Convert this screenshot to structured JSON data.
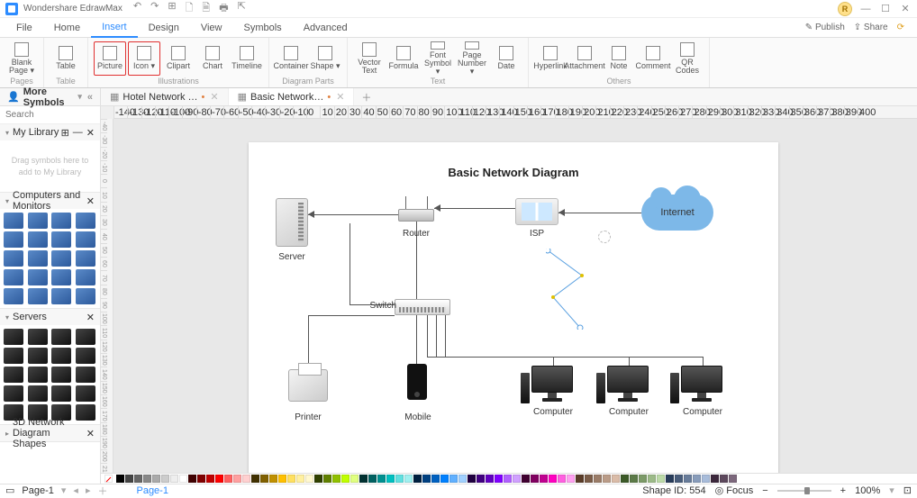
{
  "app": {
    "title": "Wondershare EdrawMax"
  },
  "qat": [
    "↶",
    "↷",
    "⊞",
    "🗋",
    "🗎",
    "🖶",
    "⇱"
  ],
  "winbtns": [
    "—",
    "☐",
    "✕"
  ],
  "avatar": "R",
  "menu": {
    "tabs": [
      "File",
      "Home",
      "Insert",
      "Design",
      "View",
      "Symbols",
      "Advanced"
    ],
    "active": "Insert",
    "right": [
      "✎ Publish",
      "⇪ Share"
    ]
  },
  "ribbon": {
    "groups": [
      {
        "label": "Pages",
        "items": [
          {
            "label": "Blank\nPage ▾"
          }
        ]
      },
      {
        "label": "Table",
        "items": [
          {
            "label": "Table"
          }
        ]
      },
      {
        "label": "Illustrations",
        "items": [
          {
            "label": "Picture"
          },
          {
            "label": "Icon\n▾"
          },
          {
            "label": "Clipart"
          },
          {
            "label": "Chart"
          },
          {
            "label": "Timeline"
          }
        ],
        "highlight": [
          0,
          1
        ]
      },
      {
        "label": "Diagram Parts",
        "items": [
          {
            "label": "Container"
          },
          {
            "label": "Shape\n▾"
          }
        ]
      },
      {
        "label": "Text",
        "items": [
          {
            "label": "Vector\nText"
          },
          {
            "label": "Formula"
          },
          {
            "label": "Font\nSymbol ▾"
          },
          {
            "label": "Page\nNumber ▾"
          },
          {
            "label": "Date"
          }
        ]
      },
      {
        "label": "Others",
        "items": [
          {
            "label": "Hyperlink"
          },
          {
            "label": "Attachment"
          },
          {
            "label": "Note"
          },
          {
            "label": "Comment"
          },
          {
            "label": "QR\nCodes"
          }
        ]
      }
    ]
  },
  "more_symbols": "More Symbols",
  "search_placeholder": "Search",
  "panels": [
    {
      "title": "My Library",
      "empty": "Drag symbols\nhere to add to\nMy Library",
      "tools": [
        "⊞",
        "—",
        "✕"
      ]
    },
    {
      "title": "Computers and Monitors",
      "tools": [
        "✕"
      ],
      "count": 20,
      "style": "blue"
    },
    {
      "title": "Servers",
      "tools": [
        "✕"
      ],
      "count": 20,
      "style": "dark"
    },
    {
      "title": "3D Network Diagram Shapes",
      "tools": [
        "✕"
      ],
      "collapsed": true
    }
  ],
  "doctabs": [
    {
      "label": "Hotel Network …",
      "active": false
    },
    {
      "label": "Basic Network…",
      "active": true
    }
  ],
  "ruler_ticks": [
    "-140",
    "-130",
    "-120",
    "-110",
    "-100",
    "-90",
    "-80",
    "-70",
    "-60",
    "-50",
    "-40",
    "-30",
    "-20",
    "-10",
    "0",
    "10",
    "20",
    "30",
    "40",
    "50",
    "60",
    "70",
    "80",
    "90",
    "100",
    "110",
    "120",
    "130",
    "140",
    "150",
    "160",
    "170",
    "180",
    "190",
    "200",
    "210",
    "220",
    "230",
    "240",
    "250",
    "260",
    "270",
    "280",
    "290",
    "300",
    "310",
    "320",
    "330",
    "340",
    "350",
    "360",
    "370",
    "380",
    "390",
    "400"
  ],
  "diagram": {
    "title": "Basic Network Diagram",
    "nodes": {
      "server": "Server",
      "router": "Router",
      "isp": "ISP",
      "internet": "Internet",
      "switch": "Switch",
      "printer": "Printer",
      "mobile": "Mobile",
      "computer": "Computer"
    }
  },
  "palette_colors": [
    "#000",
    "#444",
    "#666",
    "#888",
    "#aaa",
    "#ccc",
    "#eee",
    "#fff",
    "#400000",
    "#800000",
    "#c00000",
    "#ff0000",
    "#ff6060",
    "#ffa0a0",
    "#ffd0d0",
    "#403000",
    "#806000",
    "#c09000",
    "#ffc000",
    "#ffe060",
    "#fff0a0",
    "#fff8d0",
    "#304000",
    "#608000",
    "#90c000",
    "#c0ff00",
    "#e0ff80",
    "#003030",
    "#006060",
    "#009090",
    "#00c0c0",
    "#60e0e0",
    "#a0f0f0",
    "#002040",
    "#004080",
    "#0060c0",
    "#0080ff",
    "#60b0ff",
    "#a0d0ff",
    "#200040",
    "#400080",
    "#6000c0",
    "#8000ff",
    "#b060ff",
    "#d0a0ff",
    "#400030",
    "#800060",
    "#c00090",
    "#ff00c0",
    "#ff60e0",
    "#ffa0f0",
    "#5a3c28",
    "#7a5c48",
    "#9a7c68",
    "#ba9c88",
    "#dabca8",
    "#3c5a28",
    "#5c7a48",
    "#7c9a68",
    "#9cba88",
    "#bcdaa8",
    "#283c5a",
    "#485c7a",
    "#687c9a",
    "#889cba",
    "#a8bcda",
    "#3c283c",
    "#5c485c",
    "#7c687c"
  ],
  "status": {
    "page": "Page-1",
    "shape_id": "Shape ID: 554",
    "focus": "Focus",
    "zoom": "100%"
  }
}
